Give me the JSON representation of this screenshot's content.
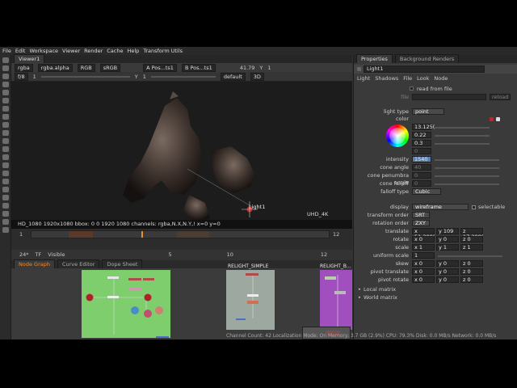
{
  "menu": [
    "File",
    "Edit",
    "Workspace",
    "Viewer",
    "Render",
    "Cache",
    "Help",
    "Transform Utils"
  ],
  "viewer": {
    "tab": "Viewer1",
    "row1": {
      "channels": "rgba",
      "layer": "rgba.alpha",
      "colorspace": "RGB",
      "lut": "sRGB",
      "a_input": "A  Pos...ts1",
      "b_input": "B  Pos...ts1",
      "fstop": "41.79",
      "y_label": "Y",
      "y_value": "1"
    },
    "row2": {
      "frame": "f/8",
      "gain": "1",
      "gamma_label": "Y",
      "gamma": "1",
      "proxy": "default",
      "mode": "3D"
    },
    "light_label": "Light1",
    "format_label": "UHD_4K",
    "info": "HD_1080 1920x1080  bbox: 0 0 1920 1080 channels: rgba,N.X,N.Y,! x=0 y=0",
    "timeline": {
      "start": "1",
      "end": "12",
      "fps": "24*",
      "tf": "TF",
      "visible": "Visible",
      "frame": "5",
      "range_end": "10",
      "end_field": "12"
    }
  },
  "nodegraph": {
    "tabs": [
      "Node Graph",
      "Curve Editor",
      "Dope Sheet"
    ],
    "backdrops": [
      {
        "label": "",
        "color": "#7fce6e"
      },
      {
        "label": "RELIGHT_SIMPLE",
        "color": "#9da8a0"
      },
      {
        "label": "RELIGHT_B...",
        "color": "#a14fbf"
      }
    ]
  },
  "properties": {
    "tabs": [
      "Properties",
      "Background Renders"
    ],
    "node_name": "Light1",
    "subtabs": [
      "Light",
      "Shadows",
      "File",
      "Look",
      "Node"
    ],
    "read_from_file": "read from file",
    "file_label": "file",
    "reload": "reload",
    "light_type_label": "light type",
    "light_type": "point",
    "color_label": "color",
    "color_values": [
      "13.125(",
      "0.22",
      "0.3",
      "0"
    ],
    "intensity_label": "intensity",
    "intensity": "1540",
    "cone_angle_label": "cone angle",
    "cone_angle": "40",
    "cone_penumbra_label": "cone penumbra angle",
    "cone_penumbra": "0",
    "cone_falloff_label": "cone falloff",
    "cone_falloff": "0",
    "falloff_type_label": "falloff type",
    "falloff_type": "Cubic",
    "display_label": "display",
    "display": "wireframe",
    "selectable": "selectable",
    "transform_order_label": "transform order",
    "transform_order": "SRT",
    "rotation_order_label": "rotation order",
    "rotation_order": "ZXY",
    "translate": {
      "label": "translate",
      "x": "x 51.200(",
      "y": "y 109",
      "z": "z 17.200("
    },
    "rotate": {
      "label": "rotate",
      "x": "x 0",
      "y": "y 0",
      "z": "z 0"
    },
    "scale": {
      "label": "scale",
      "x": "x 1",
      "y": "y 1",
      "z": "z 1"
    },
    "uniform_scale": {
      "label": "uniform scale",
      "v": "1"
    },
    "skew": {
      "label": "skew",
      "x": "x 0",
      "y": "y 0",
      "z": "z 0"
    },
    "pivot_translate": {
      "label": "pivot translate",
      "x": "x 0",
      "y": "y 0",
      "z": "z 0"
    },
    "pivot_rotate": {
      "label": "pivot rotate",
      "x": "x 0",
      "y": "y 0",
      "z": "z 0"
    },
    "local_matrix": "Local matrix",
    "world_matrix": "World matrix"
  },
  "status": "Channel Count: 42  Localization Mode: On  Memory: 3.7 GB (2.9%)  CPU: 79.3%  Disk: 0.0 MB/s  Network: 0.0 MB/s",
  "colors": {
    "accent": "#f28a2c",
    "light_node": "#c0262b",
    "intensity_highlight": "#5b7fb3"
  }
}
